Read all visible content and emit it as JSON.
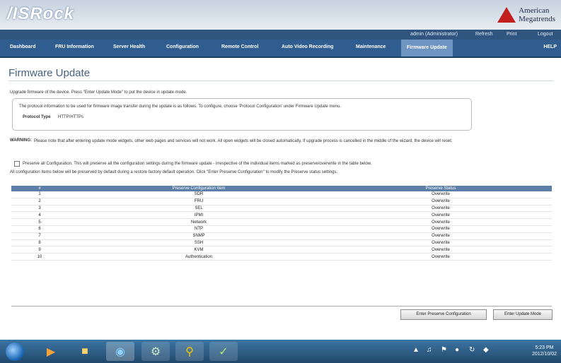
{
  "header": {
    "brand": "/ISRock",
    "ami_line1": "American",
    "ami_line2": "Megatrends"
  },
  "utility": {
    "user": "admin (Administrator)",
    "refresh": "Refresh",
    "print": "Print",
    "logout": "Logout"
  },
  "nav": {
    "items": [
      "Dashboard",
      "FRU Information",
      "Server Health",
      "Configuration",
      "Remote Control",
      "Auto Video Recording",
      "Maintenance",
      "Firmware Update"
    ],
    "help": "HELP"
  },
  "page": {
    "title": "Firmware Update",
    "intro": "Upgrade firmware of the device. Press \"Enter Update Mode\" to put the device in update mode.",
    "protocol_note": "The protocol information to be used for firmware image transfer during the update is as follows. To configure, choose 'Protocol Configuration' under Firmware Update menu.",
    "protocol_label": "Protocol Type",
    "protocol_value": "HTTP/HTTPs",
    "warning_label": "WARNING:",
    "warning_text": "Please note that after entering update mode widgets, other web pages and services will not work. All open widgets will be closed automatically. If upgrade process is cancelled in the middle of the wizard, the device will reset.",
    "preserve_text": "Preserve all Configuration. This will preserve all the configuration settings during the firmware update - irrespective of the individual items marked as preserve/overwrite in the table below.",
    "preserve_note": "All configuration items below will be preserved by default during a restore factory default operation. Click \"Enter Preserve Configuration\" to modify the Preserve status settings."
  },
  "table": {
    "headers": [
      "#",
      "Preserve Configuration Item",
      "Preserve Status"
    ],
    "rows": [
      [
        "1",
        "SDR",
        "Overwrite"
      ],
      [
        "2",
        "FRU",
        "Overwrite"
      ],
      [
        "3",
        "SEL",
        "Overwrite"
      ],
      [
        "4",
        "IPMI",
        "Overwrite"
      ],
      [
        "5",
        "Network",
        "Overwrite"
      ],
      [
        "6",
        "NTP",
        "Overwrite"
      ],
      [
        "7",
        "SNMP",
        "Overwrite"
      ],
      [
        "8",
        "SSH",
        "Overwrite"
      ],
      [
        "9",
        "KVM",
        "Overwrite"
      ],
      [
        "10",
        "Authentication",
        "Overwrite"
      ]
    ]
  },
  "buttons": {
    "preserve": "Enter Preserve Configuration",
    "update": "Enter Update Mode"
  },
  "taskbar": {
    "time": "5:23 PM",
    "date": "2012/10/02"
  },
  "colors": {
    "nav_bg": "#2f5d8f",
    "nav_active": "#6e95c1",
    "table_header": "#5b7fa6"
  }
}
